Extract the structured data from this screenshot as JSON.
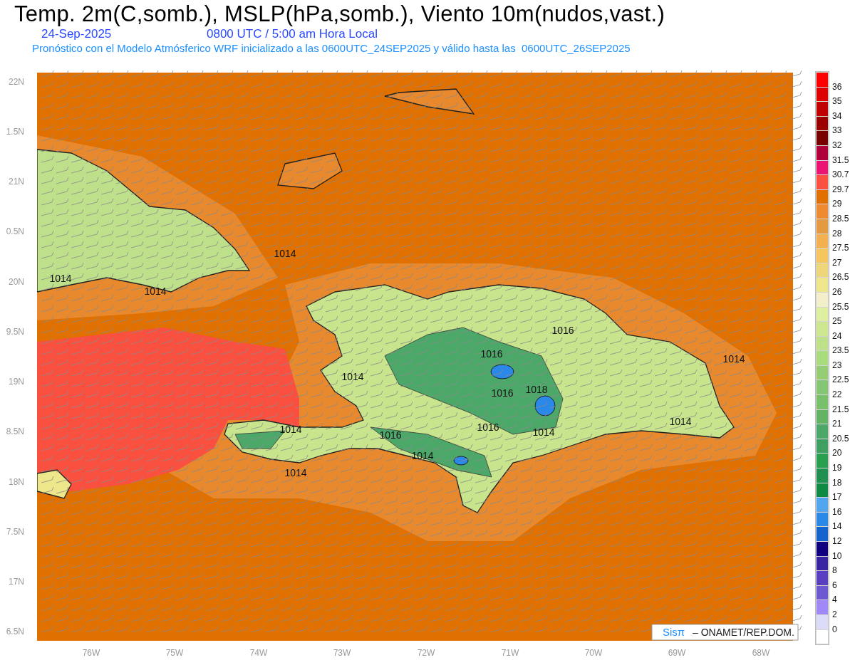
{
  "title": "Temp. 2m(C,somb.), MSLP(hPa,somb.), Viento 10m(nudos,vast.)",
  "date": "24-Sep-2025",
  "time": "0800 UTC / 5:00 am Hora Local",
  "model_note": "Pronóstico con el Modelo Atmósferico WRF inicializado a las 0600UTC_24SEP2025 y válido hasta las  0600UTC_26SEP2025",
  "y_axis_labels": [
    "22N",
    "1.5N",
    "21N",
    "0.5N",
    "20N",
    "9.5N",
    "19N",
    "8.5N",
    "18N",
    "7.5N",
    "17N",
    "6.5N"
  ],
  "x_axis_labels": [
    "76W",
    "75W",
    "74W",
    "73W",
    "72W",
    "71W",
    "70W",
    "69W",
    "68W"
  ],
  "contour_labels": [
    "1014",
    "1014",
    "1014",
    "1016",
    "1016",
    "1014",
    "1014",
    "1016",
    "1018",
    "1014",
    "1016",
    "1016",
    "1014",
    "1014",
    "1014",
    "1014"
  ],
  "credit": {
    "brand": "Sisπ",
    "text": "– ONAMET/REP.DOM."
  },
  "legend": [
    {
      "color": "#ff0000",
      "label": "36"
    },
    {
      "color": "#dd0000",
      "label": "35"
    },
    {
      "color": "#c00000",
      "label": "34"
    },
    {
      "color": "#9a0000",
      "label": "33"
    },
    {
      "color": "#780000",
      "label": "32"
    },
    {
      "color": "#b0003a",
      "label": "31.5"
    },
    {
      "color": "#ec1472",
      "label": "30.7"
    },
    {
      "color": "#fa5040",
      "label": "29.7"
    },
    {
      "color": "#e07000",
      "label": "29"
    },
    {
      "color": "#f08a30",
      "label": "28.5"
    },
    {
      "color": "#e39a40",
      "label": "28"
    },
    {
      "color": "#f2b050",
      "label": "27.5"
    },
    {
      "color": "#f5c560",
      "label": "27"
    },
    {
      "color": "#efd67a",
      "label": "26.5"
    },
    {
      "color": "#eee68a",
      "label": "26"
    },
    {
      "color": "#f2efca",
      "label": "25.5"
    },
    {
      "color": "#def0a0",
      "label": "25"
    },
    {
      "color": "#cde690",
      "label": "24"
    },
    {
      "color": "#bde088",
      "label": "23.5"
    },
    {
      "color": "#a8dc7c",
      "label": "23"
    },
    {
      "color": "#96cc74",
      "label": "22.5"
    },
    {
      "color": "#84c674",
      "label": "22"
    },
    {
      "color": "#78c06a",
      "label": "21.5"
    },
    {
      "color": "#62b464",
      "label": "21"
    },
    {
      "color": "#4ca868",
      "label": "20.5"
    },
    {
      "color": "#3ea060",
      "label": "20"
    },
    {
      "color": "#28a050",
      "label": "19"
    },
    {
      "color": "#209050",
      "label": "18"
    },
    {
      "color": "#0e8a44",
      "label": "17"
    },
    {
      "color": "#52a6f0",
      "label": "16"
    },
    {
      "color": "#2a88e8",
      "label": "14"
    },
    {
      "color": "#1464d0",
      "label": "12"
    },
    {
      "color": "#100080",
      "label": "10"
    },
    {
      "color": "#3824a0",
      "label": "8"
    },
    {
      "color": "#5a40c0",
      "label": "6"
    },
    {
      "color": "#6e5ad0",
      "label": "4"
    },
    {
      "color": "#a088f8",
      "label": "2"
    },
    {
      "color": "#dcdcf8",
      "label": "0"
    },
    {
      "color": "#ffffff"
    }
  ]
}
